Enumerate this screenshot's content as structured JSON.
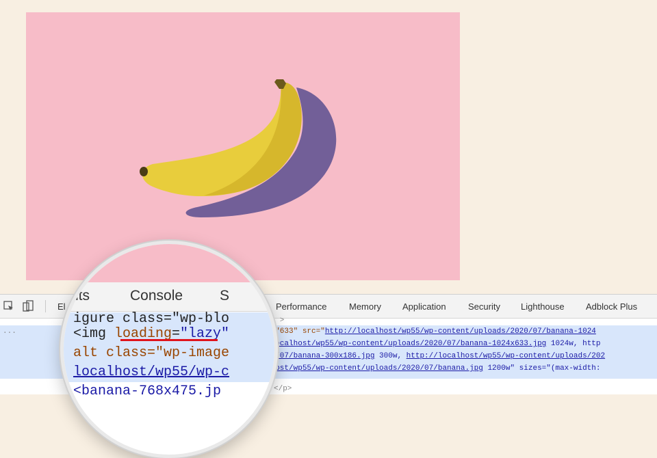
{
  "devtools": {
    "tabs": [
      "Elements",
      "Console",
      "Sources",
      "Network",
      "Performance",
      "Memory",
      "Application",
      "Security",
      "Lighthouse",
      "Adblock Plus"
    ],
    "visible_tabs": {
      "elements_partial": "El",
      "network_partial": "ork",
      "performance": "Performance",
      "memory": "Memory",
      "application": "Application",
      "security": "Security",
      "lighthouse": "Lighthouse",
      "adblock": "Adblock Plus"
    },
    "icons": [
      "inspect-element-icon",
      "device-toolbar-icon"
    ],
    "code_lines": {
      "l0": "__media >",
      "l1a": "height=\"633\" src=\"",
      "l1b": "http://localhost/wp55/wp-content/uploads/2020/07/banana-1024",
      "l2a": "ttp://localhost/wp55/wp-content/uploads/2020/07/banana-1024x633.jpg",
      "l2b": " 1024w, http",
      "l3a": "ds/2020/07/banana-300x186.jpg",
      "l3b": " 300w, ",
      "l3c": "http://localhost/wp55/wp-content/uploads/202",
      "l4a": "/localhost/wp55/wp-content/uploads/2020/07/banana.jpg",
      "l4b": " 1200w\" sizes=\"(max-width:",
      "l5": "...",
      "l6": "</p>"
    }
  },
  "magnifier": {
    "tabs": [
      "nts",
      "Console",
      "S"
    ],
    "lines": {
      "m0": "igure class=\"wp-blo",
      "m1_tag": "<img ",
      "m1_attr": "loading",
      "m1_eq": "=",
      "m1_val": "\"lazy\"",
      "m2": "alt class=\"wp-image",
      "m3": "localhost/wp55/wp-c",
      "m4": "<banana-768x475.jp"
    }
  },
  "colors": {
    "page_bg": "#f8efe2",
    "hero_bg": "#f7bcc8",
    "highlight": "#d8e6fb",
    "underline": "#e0131c"
  }
}
